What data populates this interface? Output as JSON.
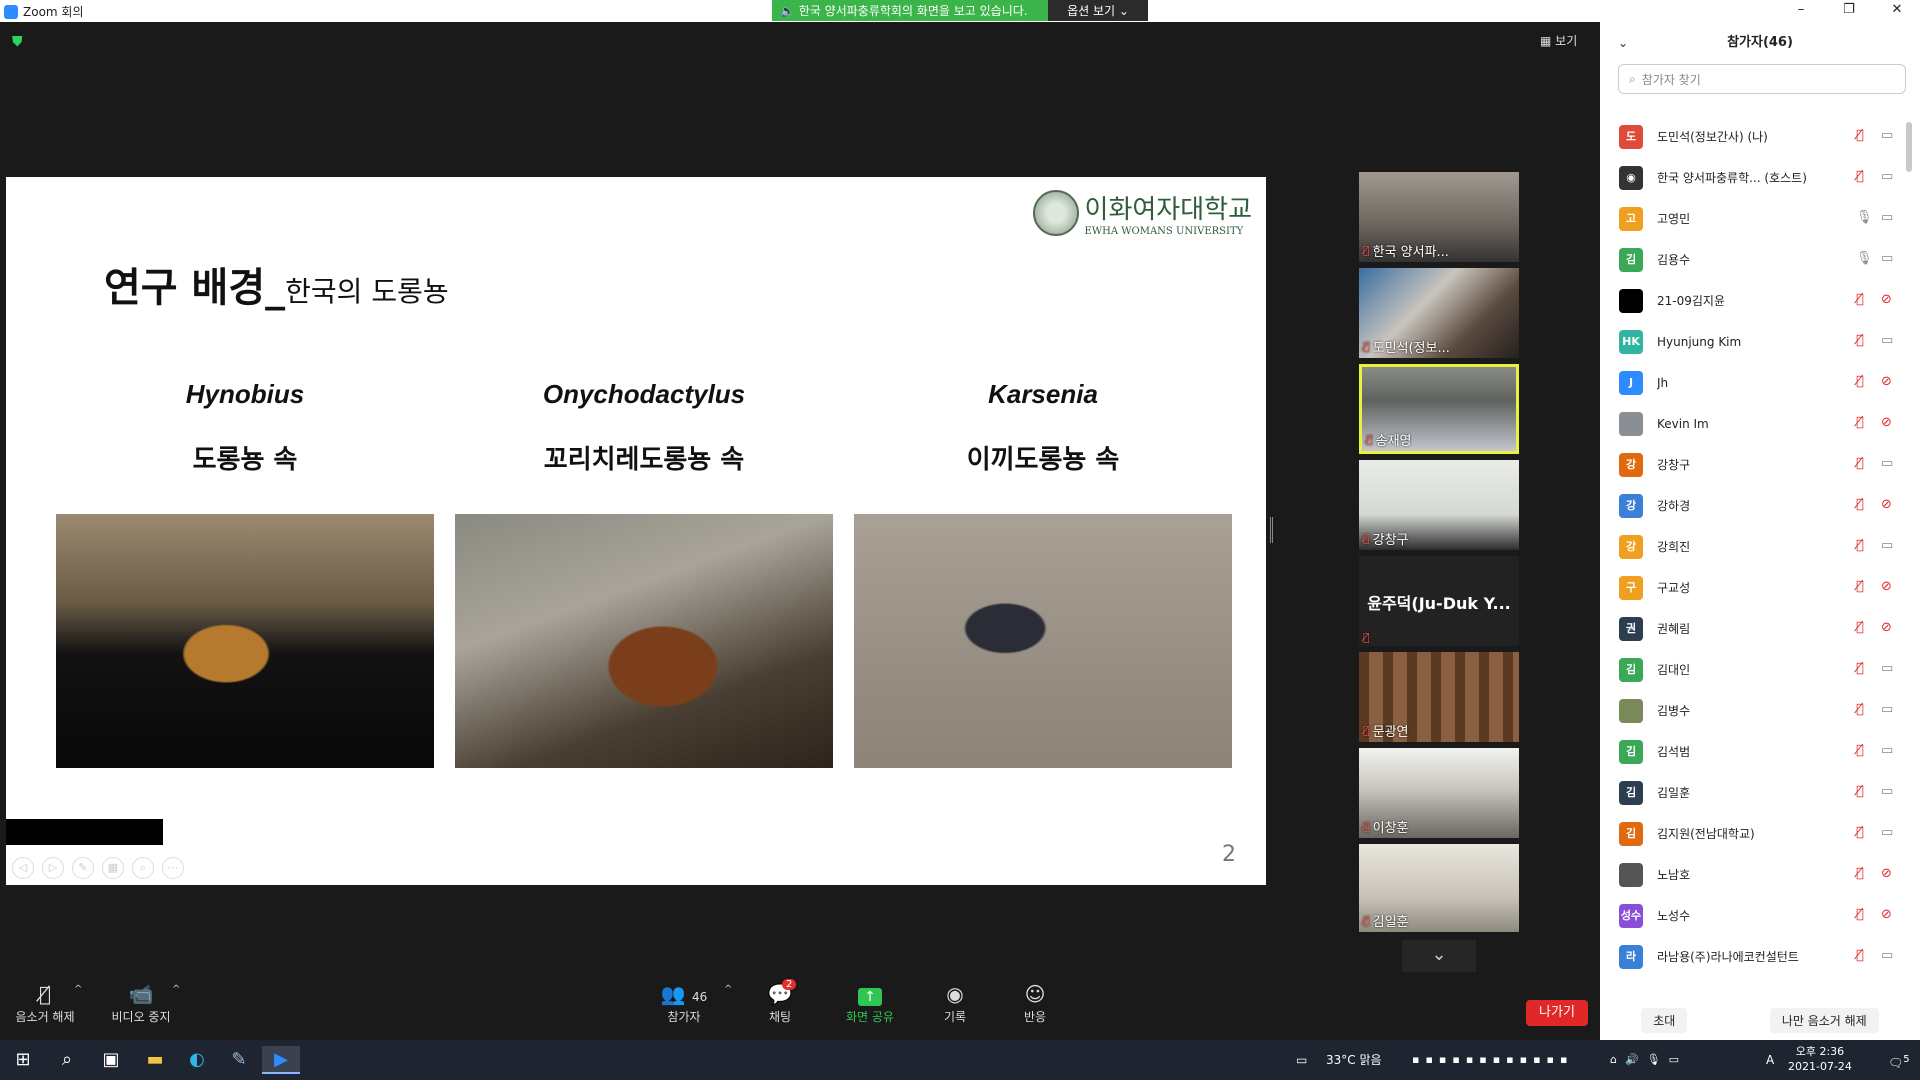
{
  "titlebar": {
    "app_title": "Zoom 회의",
    "share_message": "한국 양서파충류학회의 화면을 보고 있습니다.",
    "options_label": "옵션 보기 ⌄",
    "minimize": "–",
    "restore": "❐",
    "close": "✕"
  },
  "meeting": {
    "view_label": "보기"
  },
  "slide": {
    "university_ko": "이화여자대학교",
    "university_en": "EWHA WOMANS UNIVERSITY",
    "title_bold": "연구 배경_",
    "title_sub": "한국의 도롱뇽",
    "genera": [
      {
        "latin": "Hynobius",
        "korean": "도롱뇽 속"
      },
      {
        "latin": "Onychodactylus",
        "korean": "꼬리치레도롱뇽 속"
      },
      {
        "latin": "Karsenia",
        "korean": "이끼도롱뇽 속"
      }
    ],
    "page_number": "2"
  },
  "thumbnails": [
    {
      "name": "한국 양서파..."
    },
    {
      "name": "도민석(정보..."
    },
    {
      "name": "송재영"
    },
    {
      "name": "강창구"
    },
    {
      "name": "윤주덕(Ju-Duk Y..."
    },
    {
      "name": "문광연"
    },
    {
      "name": "이창훈"
    },
    {
      "name": "김일훈"
    }
  ],
  "toolbar": {
    "unmute": "음소거 해제",
    "stop_video": "비디오 중지",
    "participants": "참가자",
    "participant_count": "46",
    "chat": "채팅",
    "chat_badge": "2",
    "share": "화면 공유",
    "record": "기록",
    "reactions": "반응",
    "leave": "나가기"
  },
  "panel": {
    "title": "참가자(46)",
    "search_placeholder": "참가자 찾기",
    "participants": [
      {
        "name": "도민석(정보간사) (나)",
        "avatar": "도",
        "color": "#e04a3a",
        "mic": "off",
        "cam": "on"
      },
      {
        "name": "한국 양서파충류학... (호스트)",
        "avatar": "◉",
        "color": "#333333",
        "mic": "off",
        "cam": "on"
      },
      {
        "name": "고영민",
        "avatar": "고",
        "color": "#f0a020",
        "mic": "on",
        "cam": "on"
      },
      {
        "name": "김용수",
        "avatar": "김",
        "color": "#3aa856",
        "mic": "on",
        "cam": "on"
      },
      {
        "name": "21-09김지윤",
        "avatar": "",
        "color": "#000000",
        "mic": "off",
        "cam": "off"
      },
      {
        "name": "Hyunjung Kim",
        "avatar": "HK",
        "color": "#2fb5a0",
        "mic": "off",
        "cam": "on"
      },
      {
        "name": "Jh",
        "avatar": "J",
        "color": "#2d8cff",
        "mic": "off",
        "cam": "off"
      },
      {
        "name": "Kevin Im",
        "avatar": "",
        "color": "#8a8f96",
        "mic": "off",
        "cam": "off"
      },
      {
        "name": "강창구",
        "avatar": "강",
        "color": "#e06a10",
        "mic": "off",
        "cam": "on"
      },
      {
        "name": "강하경",
        "avatar": "강",
        "color": "#3a7fd8",
        "mic": "off",
        "cam": "off"
      },
      {
        "name": "강희진",
        "avatar": "강",
        "color": "#f0a020",
        "mic": "off",
        "cam": "on"
      },
      {
        "name": "구교성",
        "avatar": "구",
        "color": "#f0a020",
        "mic": "off",
        "cam": "off"
      },
      {
        "name": "권혜림",
        "avatar": "권",
        "color": "#2c3e50",
        "mic": "off",
        "cam": "off"
      },
      {
        "name": "김대인",
        "avatar": "김",
        "color": "#3aa856",
        "mic": "off",
        "cam": "on"
      },
      {
        "name": "김병수",
        "avatar": "",
        "color": "#7a8a5a",
        "mic": "off",
        "cam": "on"
      },
      {
        "name": "김석범",
        "avatar": "김",
        "color": "#3aa856",
        "mic": "off",
        "cam": "on"
      },
      {
        "name": "김일훈",
        "avatar": "김",
        "color": "#2c3e50",
        "mic": "off",
        "cam": "on"
      },
      {
        "name": "김지원(전남대학교)",
        "avatar": "김",
        "color": "#e06a10",
        "mic": "off",
        "cam": "on"
      },
      {
        "name": "노남호",
        "avatar": "",
        "color": "#555555",
        "mic": "off",
        "cam": "off"
      },
      {
        "name": "노성수",
        "avatar": "성수",
        "color": "#8a4fd8",
        "mic": "off",
        "cam": "off"
      },
      {
        "name": "라남용(주)라나에코컨설턴트",
        "avatar": "라",
        "color": "#3a7fd8",
        "mic": "off",
        "cam": "on"
      }
    ],
    "invite": "초대",
    "unmute_me": "나만 음소거 해제"
  },
  "taskbar": {
    "weather": "33°C 맑음",
    "time": "오후 2:36",
    "date": "2021-07-24",
    "ime": "A",
    "notifications": "5"
  }
}
